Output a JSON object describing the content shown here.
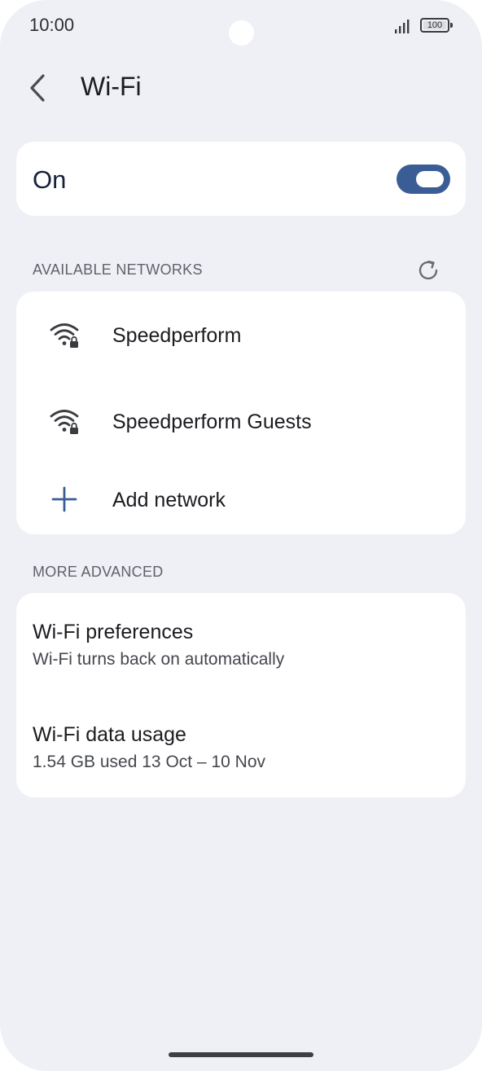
{
  "status_bar": {
    "time": "10:00",
    "battery": "100"
  },
  "header": {
    "title": "Wi-Fi"
  },
  "master_switch": {
    "label": "On",
    "enabled": true
  },
  "available_networks": {
    "header": "AVAILABLE NETWORKS",
    "items": [
      {
        "label": "Speedperform",
        "icon": "wifi-locked-icon"
      },
      {
        "label": "Speedperform Guests",
        "icon": "wifi-locked-icon"
      }
    ],
    "add_label": "Add network"
  },
  "more_advanced": {
    "header": "MORE ADVANCED",
    "items": [
      {
        "title": "Wi-Fi preferences",
        "subtitle": "Wi-Fi turns back on automatically"
      },
      {
        "title": "Wi-Fi data usage",
        "subtitle": "1.54 GB used 13 Oct – 10 Nov"
      }
    ]
  },
  "colors": {
    "background": "#eef0f5",
    "accent": "#3b5d96",
    "card": "#ffffff"
  }
}
